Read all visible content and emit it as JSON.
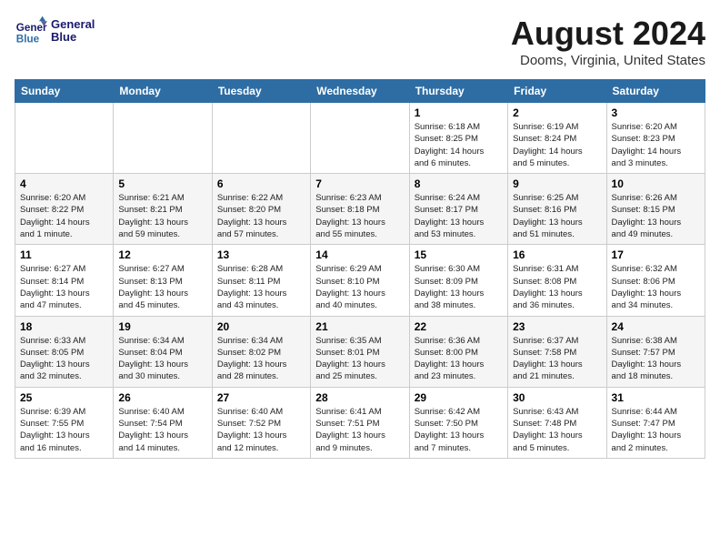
{
  "header": {
    "logo_line1": "General",
    "logo_line2": "Blue",
    "title": "August 2024",
    "subtitle": "Dooms, Virginia, United States"
  },
  "days_of_week": [
    "Sunday",
    "Monday",
    "Tuesday",
    "Wednesday",
    "Thursday",
    "Friday",
    "Saturday"
  ],
  "weeks": [
    [
      {
        "day": "",
        "info": ""
      },
      {
        "day": "",
        "info": ""
      },
      {
        "day": "",
        "info": ""
      },
      {
        "day": "",
        "info": ""
      },
      {
        "day": "1",
        "info": "Sunrise: 6:18 AM\nSunset: 8:25 PM\nDaylight: 14 hours\nand 6 minutes."
      },
      {
        "day": "2",
        "info": "Sunrise: 6:19 AM\nSunset: 8:24 PM\nDaylight: 14 hours\nand 5 minutes."
      },
      {
        "day": "3",
        "info": "Sunrise: 6:20 AM\nSunset: 8:23 PM\nDaylight: 14 hours\nand 3 minutes."
      }
    ],
    [
      {
        "day": "4",
        "info": "Sunrise: 6:20 AM\nSunset: 8:22 PM\nDaylight: 14 hours\nand 1 minute."
      },
      {
        "day": "5",
        "info": "Sunrise: 6:21 AM\nSunset: 8:21 PM\nDaylight: 13 hours\nand 59 minutes."
      },
      {
        "day": "6",
        "info": "Sunrise: 6:22 AM\nSunset: 8:20 PM\nDaylight: 13 hours\nand 57 minutes."
      },
      {
        "day": "7",
        "info": "Sunrise: 6:23 AM\nSunset: 8:18 PM\nDaylight: 13 hours\nand 55 minutes."
      },
      {
        "day": "8",
        "info": "Sunrise: 6:24 AM\nSunset: 8:17 PM\nDaylight: 13 hours\nand 53 minutes."
      },
      {
        "day": "9",
        "info": "Sunrise: 6:25 AM\nSunset: 8:16 PM\nDaylight: 13 hours\nand 51 minutes."
      },
      {
        "day": "10",
        "info": "Sunrise: 6:26 AM\nSunset: 8:15 PM\nDaylight: 13 hours\nand 49 minutes."
      }
    ],
    [
      {
        "day": "11",
        "info": "Sunrise: 6:27 AM\nSunset: 8:14 PM\nDaylight: 13 hours\nand 47 minutes."
      },
      {
        "day": "12",
        "info": "Sunrise: 6:27 AM\nSunset: 8:13 PM\nDaylight: 13 hours\nand 45 minutes."
      },
      {
        "day": "13",
        "info": "Sunrise: 6:28 AM\nSunset: 8:11 PM\nDaylight: 13 hours\nand 43 minutes."
      },
      {
        "day": "14",
        "info": "Sunrise: 6:29 AM\nSunset: 8:10 PM\nDaylight: 13 hours\nand 40 minutes."
      },
      {
        "day": "15",
        "info": "Sunrise: 6:30 AM\nSunset: 8:09 PM\nDaylight: 13 hours\nand 38 minutes."
      },
      {
        "day": "16",
        "info": "Sunrise: 6:31 AM\nSunset: 8:08 PM\nDaylight: 13 hours\nand 36 minutes."
      },
      {
        "day": "17",
        "info": "Sunrise: 6:32 AM\nSunset: 8:06 PM\nDaylight: 13 hours\nand 34 minutes."
      }
    ],
    [
      {
        "day": "18",
        "info": "Sunrise: 6:33 AM\nSunset: 8:05 PM\nDaylight: 13 hours\nand 32 minutes."
      },
      {
        "day": "19",
        "info": "Sunrise: 6:34 AM\nSunset: 8:04 PM\nDaylight: 13 hours\nand 30 minutes."
      },
      {
        "day": "20",
        "info": "Sunrise: 6:34 AM\nSunset: 8:02 PM\nDaylight: 13 hours\nand 28 minutes."
      },
      {
        "day": "21",
        "info": "Sunrise: 6:35 AM\nSunset: 8:01 PM\nDaylight: 13 hours\nand 25 minutes."
      },
      {
        "day": "22",
        "info": "Sunrise: 6:36 AM\nSunset: 8:00 PM\nDaylight: 13 hours\nand 23 minutes."
      },
      {
        "day": "23",
        "info": "Sunrise: 6:37 AM\nSunset: 7:58 PM\nDaylight: 13 hours\nand 21 minutes."
      },
      {
        "day": "24",
        "info": "Sunrise: 6:38 AM\nSunset: 7:57 PM\nDaylight: 13 hours\nand 18 minutes."
      }
    ],
    [
      {
        "day": "25",
        "info": "Sunrise: 6:39 AM\nSunset: 7:55 PM\nDaylight: 13 hours\nand 16 minutes."
      },
      {
        "day": "26",
        "info": "Sunrise: 6:40 AM\nSunset: 7:54 PM\nDaylight: 13 hours\nand 14 minutes."
      },
      {
        "day": "27",
        "info": "Sunrise: 6:40 AM\nSunset: 7:52 PM\nDaylight: 13 hours\nand 12 minutes."
      },
      {
        "day": "28",
        "info": "Sunrise: 6:41 AM\nSunset: 7:51 PM\nDaylight: 13 hours\nand 9 minutes."
      },
      {
        "day": "29",
        "info": "Sunrise: 6:42 AM\nSunset: 7:50 PM\nDaylight: 13 hours\nand 7 minutes."
      },
      {
        "day": "30",
        "info": "Sunrise: 6:43 AM\nSunset: 7:48 PM\nDaylight: 13 hours\nand 5 minutes."
      },
      {
        "day": "31",
        "info": "Sunrise: 6:44 AM\nSunset: 7:47 PM\nDaylight: 13 hours\nand 2 minutes."
      }
    ]
  ]
}
